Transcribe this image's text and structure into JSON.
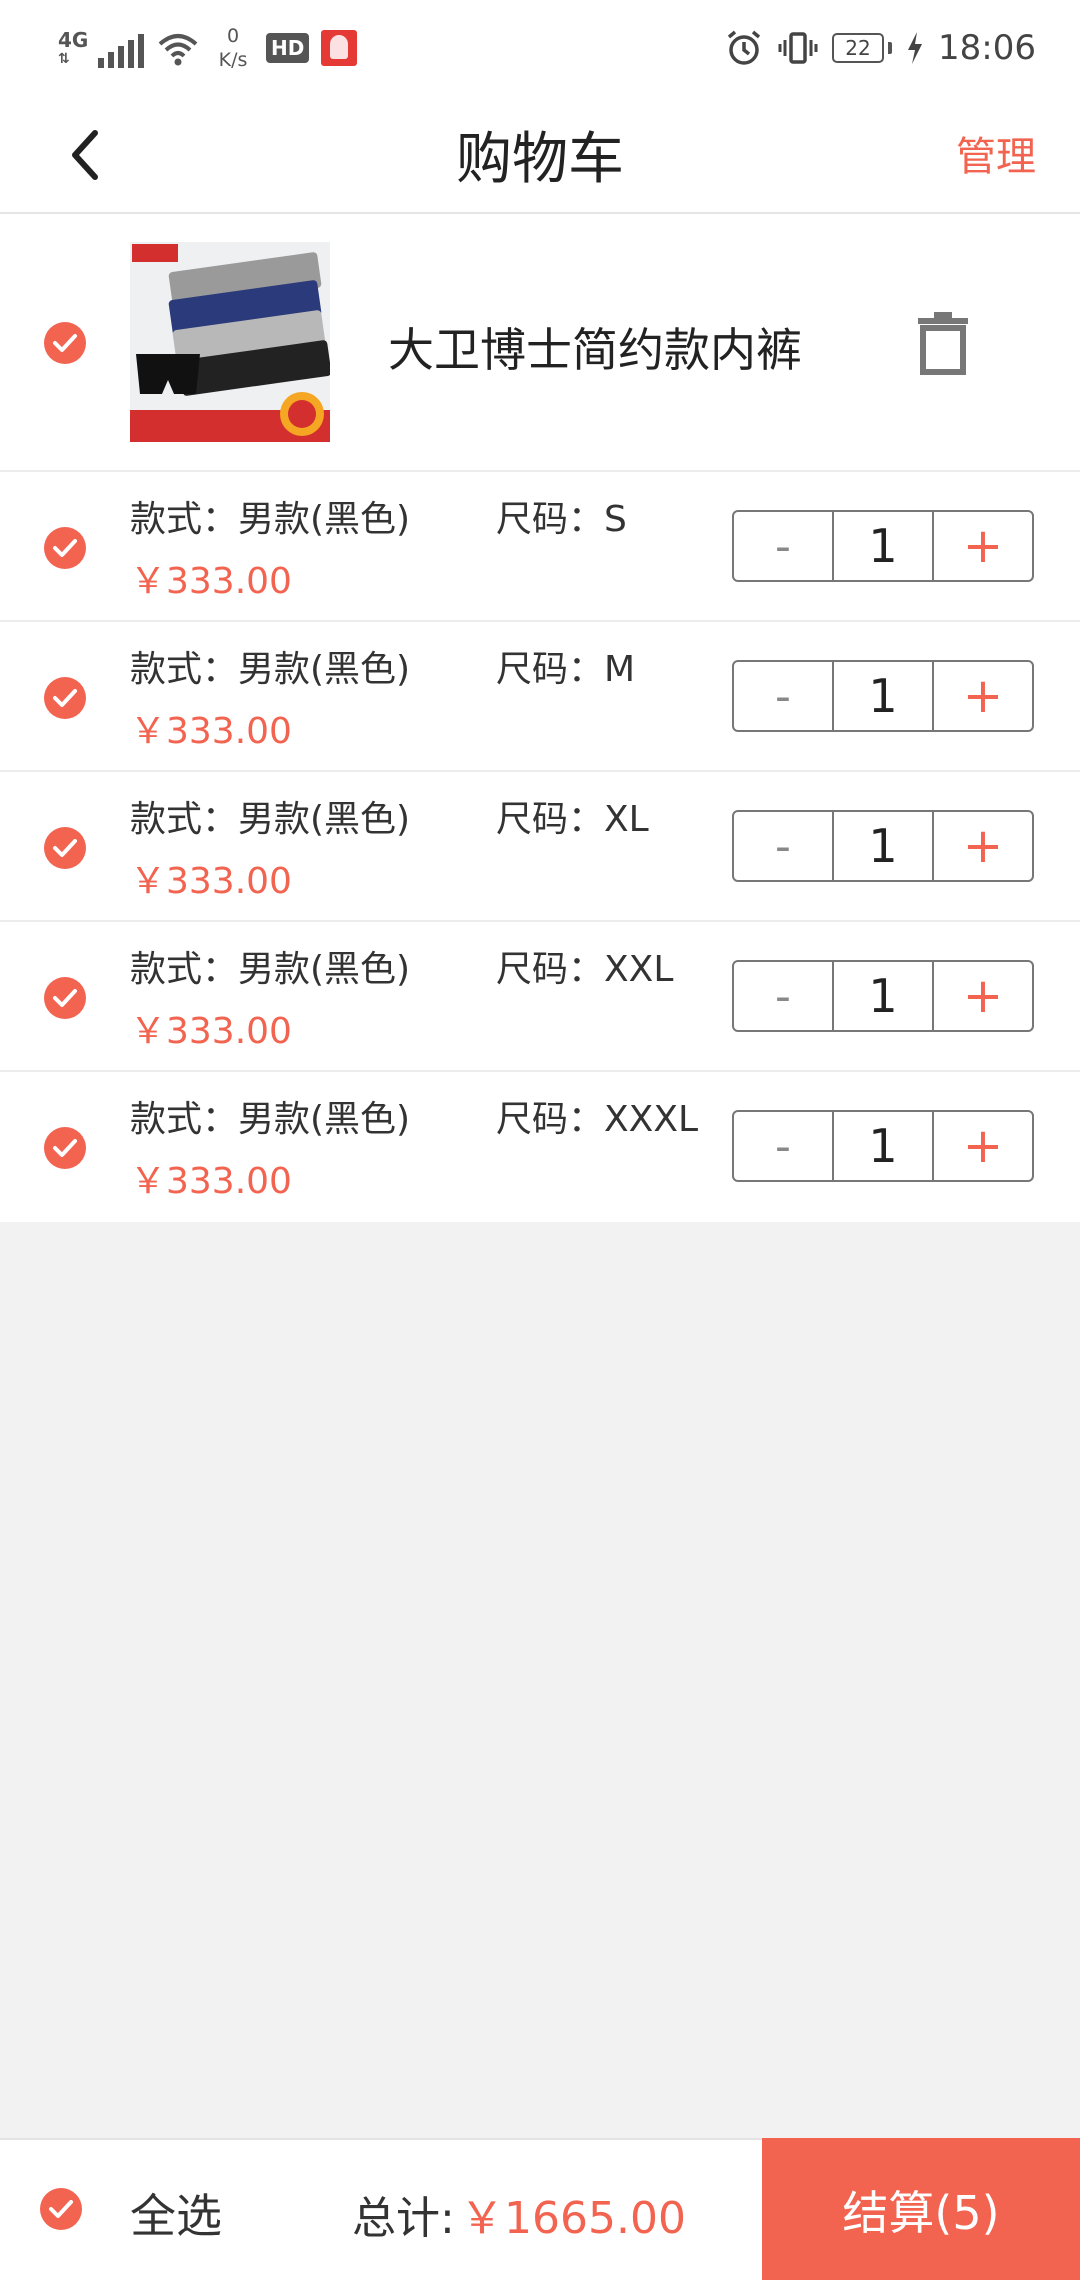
{
  "status_bar": {
    "network": "4G",
    "speed_value": "0",
    "speed_unit": "K/s",
    "hd": "HD",
    "battery": "22",
    "time": "18:06"
  },
  "nav": {
    "title": "购物车",
    "manage": "管理"
  },
  "product": {
    "name": "大卫博士简约款内裤"
  },
  "variants": [
    {
      "style": "款式：男款(黑色)",
      "size": "尺码：S",
      "price": "￥333.00",
      "qty": "1"
    },
    {
      "style": "款式：男款(黑色)",
      "size": "尺码：M",
      "price": "￥333.00",
      "qty": "1"
    },
    {
      "style": "款式：男款(黑色)",
      "size": "尺码：XL",
      "price": "￥333.00",
      "qty": "1"
    },
    {
      "style": "款式：男款(黑色)",
      "size": "尺码：XXL",
      "price": "￥333.00",
      "qty": "1"
    },
    {
      "style": "款式：男款(黑色)",
      "size": "尺码：XXXL",
      "price": "￥333.00",
      "qty": "1"
    }
  ],
  "stepper": {
    "minus": "-",
    "plus": "+"
  },
  "bottom": {
    "select_all": "全选",
    "total_label": "总计:",
    "total_value": "￥1665.00",
    "checkout": "结算(5)"
  },
  "colors": {
    "accent": "#f26350",
    "background": "#f2f2f2"
  }
}
